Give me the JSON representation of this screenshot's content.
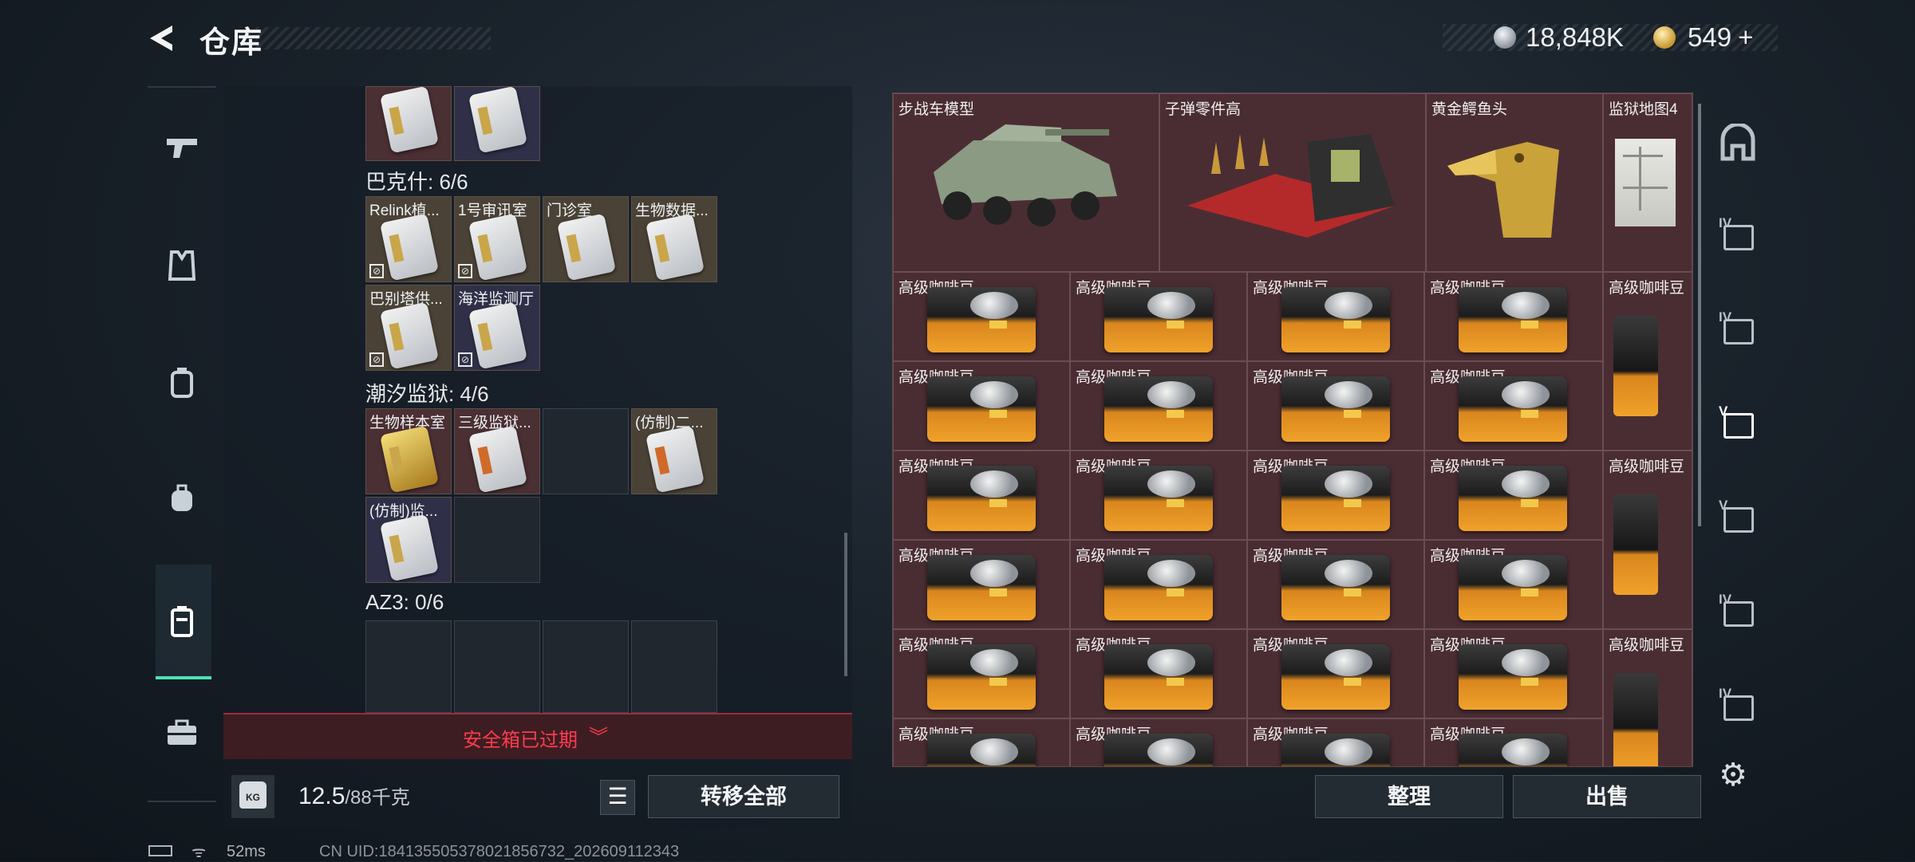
{
  "header": {
    "title": "仓库"
  },
  "currency": {
    "silver": "18,848K",
    "gold": "549",
    "gold_add": "+"
  },
  "left_nav": {
    "active": "backpack-case"
  },
  "left_panel": {
    "top_row_partial": [
      {
        "name": "",
        "bg": "red"
      },
      {
        "name": "",
        "bg": "purple"
      }
    ],
    "sections": [
      {
        "label": "巴克什: 6/6",
        "slots": [
          {
            "name": "Relink植...",
            "bg": "brown",
            "card": "silver",
            "locked": true
          },
          {
            "name": "1号审讯室",
            "bg": "brown",
            "card": "silver",
            "locked": true
          },
          {
            "name": "门诊室",
            "bg": "brown",
            "card": "silver",
            "locked": false
          },
          {
            "name": "生物数据...",
            "bg": "brown",
            "card": "silver",
            "locked": false
          },
          {
            "name": "巴别塔供...",
            "bg": "brown",
            "card": "silver",
            "locked": true
          },
          {
            "name": "海洋监测厅",
            "bg": "purple",
            "card": "silver",
            "locked": true
          }
        ]
      },
      {
        "label": "潮汐监狱: 4/6",
        "slots": [
          {
            "name": "生物样本室",
            "bg": "red",
            "card": "gold",
            "locked": false
          },
          {
            "name": "三级监狱...",
            "bg": "red",
            "card": "orange",
            "locked": false
          },
          {
            "name": "",
            "bg": "empty",
            "card": "",
            "locked": false
          },
          {
            "name": "(仿制)二...",
            "bg": "brown",
            "card": "orange",
            "locked": false
          },
          {
            "name": "(仿制)监...",
            "bg": "purple",
            "card": "silver",
            "locked": false
          },
          {
            "name": "",
            "bg": "empty",
            "card": "",
            "locked": false
          }
        ]
      },
      {
        "label": "AZ3: 0/6",
        "slots": []
      }
    ],
    "expired_text": "安全箱已过期",
    "weight_icon": "KG",
    "weight_value": "12.5",
    "weight_capacity": "/88千克",
    "transfer_all": "转移全部"
  },
  "right_panel": {
    "top_items": [
      {
        "name": "步战车模型",
        "icon": "armored-vehicle-icon"
      },
      {
        "name": "子弹零件高",
        "icon": "bullet-parts-icon"
      },
      {
        "name": "黄金鳄鱼头",
        "icon": "gold-crocodile-head-icon"
      },
      {
        "name": "监狱地图4",
        "icon": "prison-map-icon"
      }
    ],
    "coffee_label": "高级咖啡豆",
    "sort": "整理",
    "sell": "出售"
  },
  "right_nav": [
    {
      "level": "",
      "icon": "arch-icon"
    },
    {
      "level": "IV",
      "icon": "folder-icon"
    },
    {
      "level": "IV",
      "icon": "folder-icon"
    },
    {
      "level": "V",
      "icon": "camera-case-icon",
      "active": true
    },
    {
      "level": "V",
      "icon": "camera-case-icon"
    },
    {
      "level": "IV",
      "icon": "triangle-case-icon"
    },
    {
      "level": "IV",
      "icon": "folder-icon"
    }
  ],
  "status": {
    "ping": "52ms",
    "uid": "CN UID:18413550537802185​6732_202609112343"
  },
  "colors": {
    "accent": "#4de2b4",
    "warning": "#ff3b4d",
    "item_bg": "#4a2d33"
  }
}
